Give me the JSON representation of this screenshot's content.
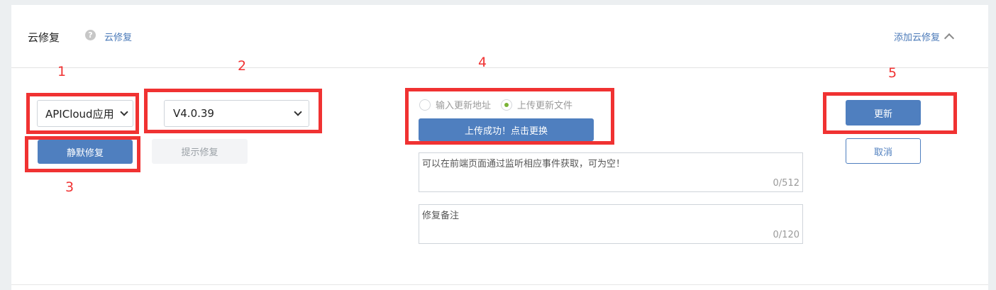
{
  "header": {
    "title": "云修复",
    "help_icon": "?",
    "link_label": "云修复",
    "add_label": "添加云修复"
  },
  "annotations": [
    "1",
    "2",
    "3",
    "4",
    "5"
  ],
  "form": {
    "app_select_value": "APICloud应用",
    "version_select_value": "V4.0.39",
    "silent_fix_label": "静默修复",
    "prompt_fix_label": "提示修复",
    "radio_options": [
      {
        "label": "输入更新地址",
        "selected": false
      },
      {
        "label": "上传更新文件",
        "selected": true
      }
    ],
    "upload_button_label": "上传成功！点击更换",
    "desc_placeholder": "可以在前端页面通过监听相应事件获取，可为空！",
    "desc_counter": "0/512",
    "note_placeholder": "修复备注",
    "note_counter": "0/120",
    "update_label": "更新",
    "cancel_label": "取消"
  },
  "colors": {
    "accent": "#4f7fbf",
    "annotation": "#f03232",
    "radio_selected": "#7ab336"
  }
}
